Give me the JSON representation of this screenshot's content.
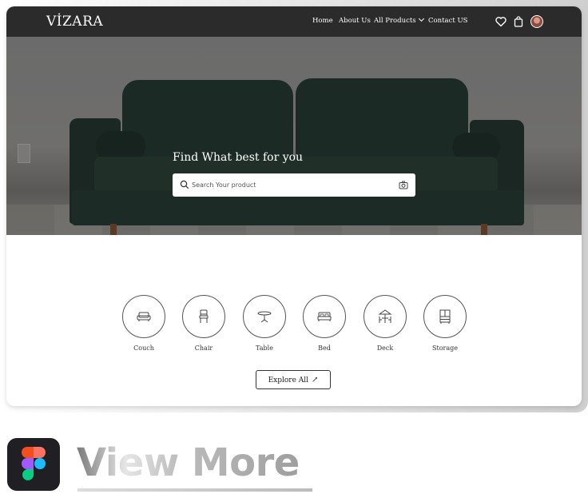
{
  "brand": {
    "logo_text": "VİZARA"
  },
  "nav": {
    "links": [
      {
        "label": "Home"
      },
      {
        "label": "About Us"
      },
      {
        "label": "All Products"
      },
      {
        "label": "Contact US"
      }
    ],
    "icons": [
      "heart-icon",
      "shopping-bag-icon",
      "avatar"
    ]
  },
  "hero": {
    "title": "Find What best for you",
    "search_placeholder": "Search Your product",
    "search_value": ""
  },
  "categories": [
    {
      "label": "Couch",
      "icon": "couch-icon"
    },
    {
      "label": "Chair",
      "icon": "chair-icon"
    },
    {
      "label": "Table",
      "icon": "table-icon"
    },
    {
      "label": "Bed",
      "icon": "bed-icon"
    },
    {
      "label": "Deck",
      "icon": "deck-icon"
    },
    {
      "label": "Storage",
      "icon": "storage-icon"
    }
  ],
  "explore_button": {
    "label": "Explore All"
  },
  "promo": {
    "view_more": "View More"
  },
  "colors": {
    "nav_bg": "#2b2b2b",
    "sofa": "#1c2a25",
    "figma_tile": "#1f1f24"
  }
}
